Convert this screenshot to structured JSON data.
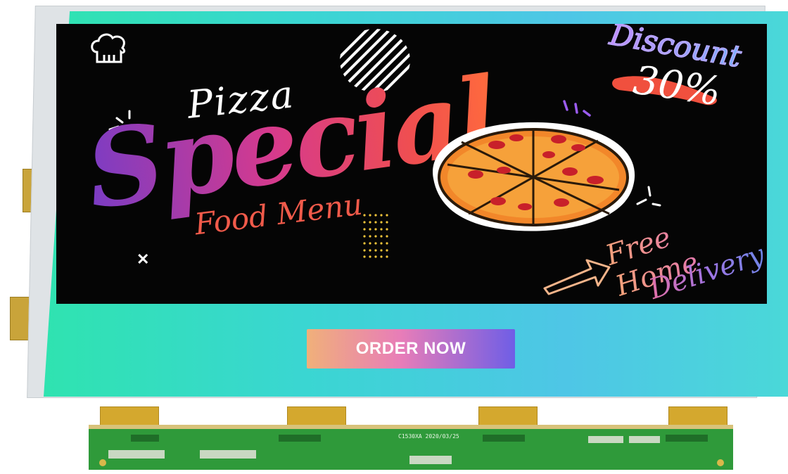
{
  "banner": {
    "title_top": "Pizza",
    "title_main": "Special",
    "subtitle": "Food Menu",
    "discount_label": "Discount",
    "discount_value": "30%",
    "delivery_line1": "Free Home",
    "delivery_line2": "Delivery"
  },
  "cta": {
    "label": "ORDER NOW"
  },
  "pcb": {
    "label": "C1530XA  2020/03/25"
  },
  "icons": [
    "chef-hat-icon",
    "pizza-icon",
    "arrow-icon",
    "cross-icon"
  ],
  "colors": {
    "screen_left": "#2fe3b0",
    "screen_right": "#4ec6e6",
    "banner_background": "#050505",
    "title_gradient_start": "#7b3cc4",
    "title_gradient_end": "#ff6a3d",
    "button_gradient_start": "#f0b07a",
    "button_gradient_end": "#6f5ee6",
    "pcb_green": "#2f9a3a"
  }
}
